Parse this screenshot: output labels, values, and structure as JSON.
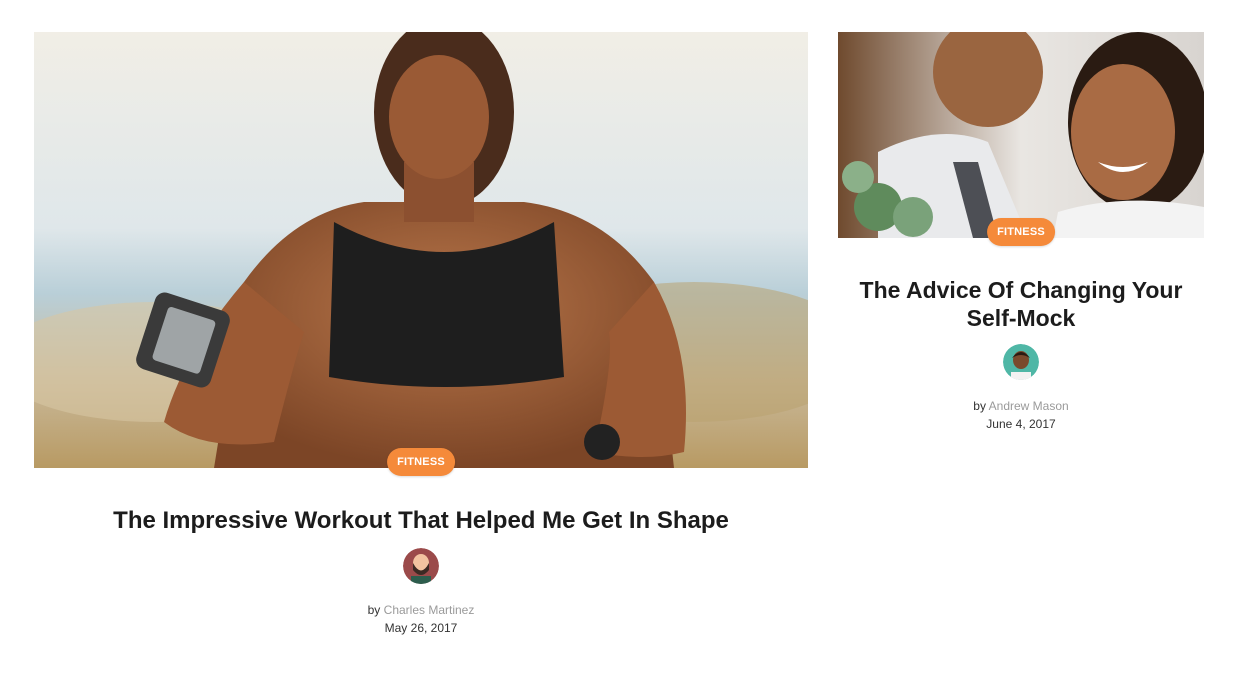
{
  "posts": [
    {
      "category": "FITNESS",
      "title": "The Impressive Workout That Helped Me Get In Shape",
      "by": "by",
      "author": "Charles Martinez",
      "date": "May 26, 2017"
    },
    {
      "category": "FITNESS",
      "title": "The Advice Of Changing Your Self-Mock",
      "by": "by",
      "author": "Andrew Mason",
      "date": "June 4, 2017"
    }
  ],
  "colors": {
    "badge": "#f58a3a",
    "author_link": "#9a9a9a",
    "title": "#1c1c1c"
  }
}
